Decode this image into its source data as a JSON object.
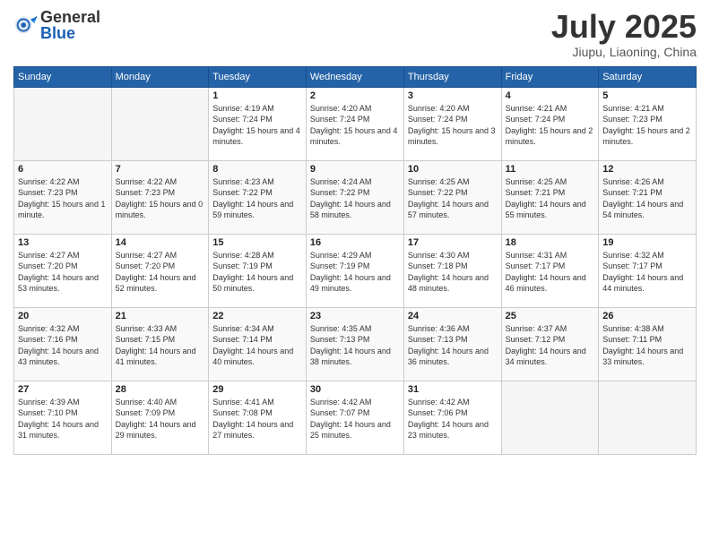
{
  "header": {
    "logo_general": "General",
    "logo_blue": "Blue",
    "month": "July 2025",
    "location": "Jiupu, Liaoning, China"
  },
  "weekdays": [
    "Sunday",
    "Monday",
    "Tuesday",
    "Wednesday",
    "Thursday",
    "Friday",
    "Saturday"
  ],
  "weeks": [
    [
      {
        "day": "",
        "info": ""
      },
      {
        "day": "",
        "info": ""
      },
      {
        "day": "1",
        "info": "Sunrise: 4:19 AM\nSunset: 7:24 PM\nDaylight: 15 hours and 4 minutes."
      },
      {
        "day": "2",
        "info": "Sunrise: 4:20 AM\nSunset: 7:24 PM\nDaylight: 15 hours and 4 minutes."
      },
      {
        "day": "3",
        "info": "Sunrise: 4:20 AM\nSunset: 7:24 PM\nDaylight: 15 hours and 3 minutes."
      },
      {
        "day": "4",
        "info": "Sunrise: 4:21 AM\nSunset: 7:24 PM\nDaylight: 15 hours and 2 minutes."
      },
      {
        "day": "5",
        "info": "Sunrise: 4:21 AM\nSunset: 7:23 PM\nDaylight: 15 hours and 2 minutes."
      }
    ],
    [
      {
        "day": "6",
        "info": "Sunrise: 4:22 AM\nSunset: 7:23 PM\nDaylight: 15 hours and 1 minute."
      },
      {
        "day": "7",
        "info": "Sunrise: 4:22 AM\nSunset: 7:23 PM\nDaylight: 15 hours and 0 minutes."
      },
      {
        "day": "8",
        "info": "Sunrise: 4:23 AM\nSunset: 7:22 PM\nDaylight: 14 hours and 59 minutes."
      },
      {
        "day": "9",
        "info": "Sunrise: 4:24 AM\nSunset: 7:22 PM\nDaylight: 14 hours and 58 minutes."
      },
      {
        "day": "10",
        "info": "Sunrise: 4:25 AM\nSunset: 7:22 PM\nDaylight: 14 hours and 57 minutes."
      },
      {
        "day": "11",
        "info": "Sunrise: 4:25 AM\nSunset: 7:21 PM\nDaylight: 14 hours and 55 minutes."
      },
      {
        "day": "12",
        "info": "Sunrise: 4:26 AM\nSunset: 7:21 PM\nDaylight: 14 hours and 54 minutes."
      }
    ],
    [
      {
        "day": "13",
        "info": "Sunrise: 4:27 AM\nSunset: 7:20 PM\nDaylight: 14 hours and 53 minutes."
      },
      {
        "day": "14",
        "info": "Sunrise: 4:27 AM\nSunset: 7:20 PM\nDaylight: 14 hours and 52 minutes."
      },
      {
        "day": "15",
        "info": "Sunrise: 4:28 AM\nSunset: 7:19 PM\nDaylight: 14 hours and 50 minutes."
      },
      {
        "day": "16",
        "info": "Sunrise: 4:29 AM\nSunset: 7:19 PM\nDaylight: 14 hours and 49 minutes."
      },
      {
        "day": "17",
        "info": "Sunrise: 4:30 AM\nSunset: 7:18 PM\nDaylight: 14 hours and 48 minutes."
      },
      {
        "day": "18",
        "info": "Sunrise: 4:31 AM\nSunset: 7:17 PM\nDaylight: 14 hours and 46 minutes."
      },
      {
        "day": "19",
        "info": "Sunrise: 4:32 AM\nSunset: 7:17 PM\nDaylight: 14 hours and 44 minutes."
      }
    ],
    [
      {
        "day": "20",
        "info": "Sunrise: 4:32 AM\nSunset: 7:16 PM\nDaylight: 14 hours and 43 minutes."
      },
      {
        "day": "21",
        "info": "Sunrise: 4:33 AM\nSunset: 7:15 PM\nDaylight: 14 hours and 41 minutes."
      },
      {
        "day": "22",
        "info": "Sunrise: 4:34 AM\nSunset: 7:14 PM\nDaylight: 14 hours and 40 minutes."
      },
      {
        "day": "23",
        "info": "Sunrise: 4:35 AM\nSunset: 7:13 PM\nDaylight: 14 hours and 38 minutes."
      },
      {
        "day": "24",
        "info": "Sunrise: 4:36 AM\nSunset: 7:13 PM\nDaylight: 14 hours and 36 minutes."
      },
      {
        "day": "25",
        "info": "Sunrise: 4:37 AM\nSunset: 7:12 PM\nDaylight: 14 hours and 34 minutes."
      },
      {
        "day": "26",
        "info": "Sunrise: 4:38 AM\nSunset: 7:11 PM\nDaylight: 14 hours and 33 minutes."
      }
    ],
    [
      {
        "day": "27",
        "info": "Sunrise: 4:39 AM\nSunset: 7:10 PM\nDaylight: 14 hours and 31 minutes."
      },
      {
        "day": "28",
        "info": "Sunrise: 4:40 AM\nSunset: 7:09 PM\nDaylight: 14 hours and 29 minutes."
      },
      {
        "day": "29",
        "info": "Sunrise: 4:41 AM\nSunset: 7:08 PM\nDaylight: 14 hours and 27 minutes."
      },
      {
        "day": "30",
        "info": "Sunrise: 4:42 AM\nSunset: 7:07 PM\nDaylight: 14 hours and 25 minutes."
      },
      {
        "day": "31",
        "info": "Sunrise: 4:42 AM\nSunset: 7:06 PM\nDaylight: 14 hours and 23 minutes."
      },
      {
        "day": "",
        "info": ""
      },
      {
        "day": "",
        "info": ""
      }
    ]
  ]
}
